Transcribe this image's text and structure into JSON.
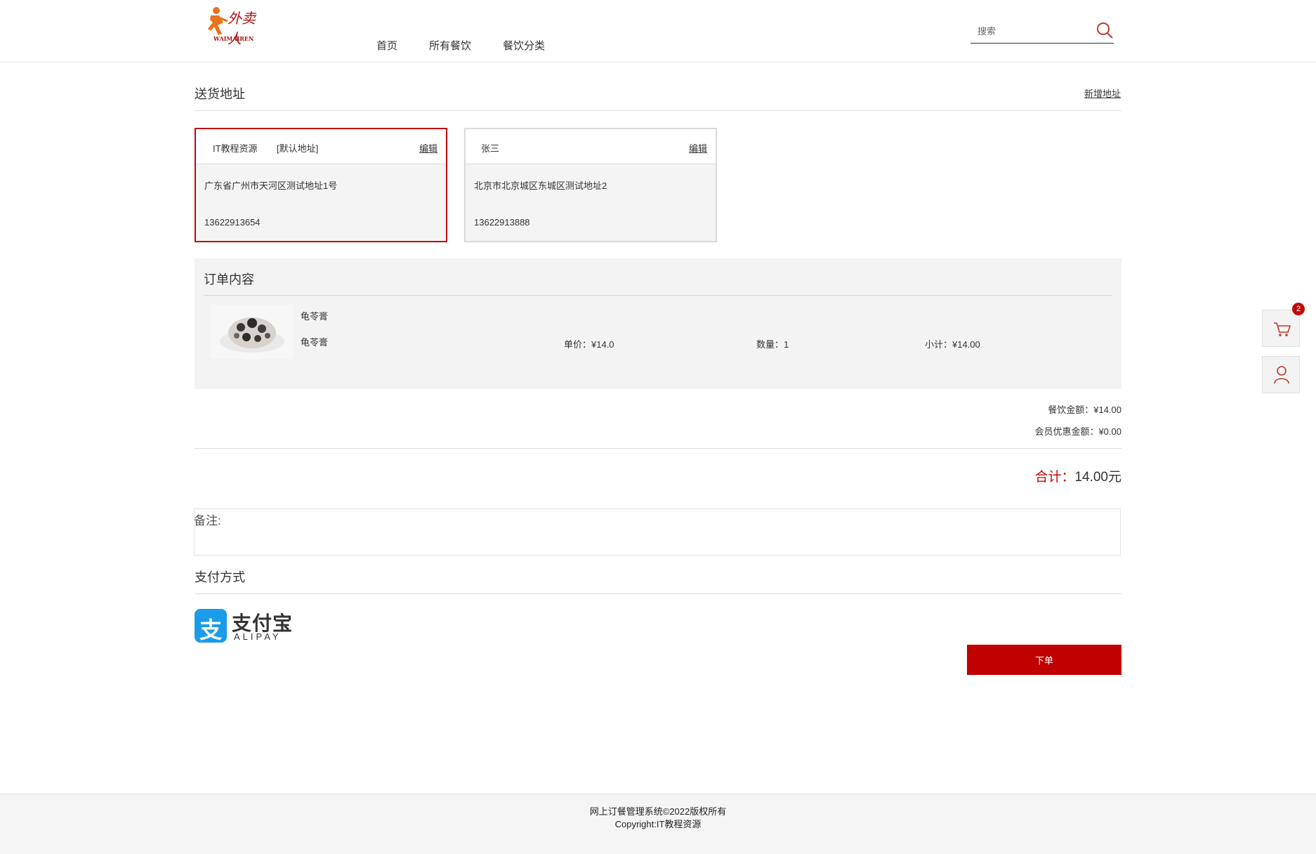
{
  "header": {
    "logo_cn": "外卖人",
    "logo_en": "WAIMAIREN",
    "nav": [
      {
        "label": "首页"
      },
      {
        "label": "所有餐饮"
      },
      {
        "label": "餐饮分类"
      }
    ],
    "search_placeholder": "搜索"
  },
  "address_section": {
    "title": "送货地址",
    "add_link": "新增地址",
    "cards": [
      {
        "name": "IT教程资源",
        "tag": "[默认地址]",
        "edit": "编辑",
        "address": "广东省广州市天河区测试地址1号",
        "phone": "13622913654",
        "selected": true
      },
      {
        "name": "张三",
        "tag": "",
        "edit": "编辑",
        "address": "北京市北京城区东城区测试地址2",
        "phone": "13622913888",
        "selected": false
      }
    ]
  },
  "order": {
    "title": "订单内容",
    "items": [
      {
        "name": "龟苓膏",
        "desc": "龟苓膏",
        "unit_price_label": "单价：¥14.0",
        "qty_label": "数量：1",
        "subtotal_label": "小计：¥14.00"
      }
    ]
  },
  "cart_badge": "2",
  "totals": {
    "food_amount": "餐饮金额：¥14.00",
    "member_discount": "会员优惠金额：¥0.00",
    "grand_label": "合计：",
    "grand_value": "14.00元"
  },
  "remark": {
    "label": "备注:",
    "value": ""
  },
  "payment": {
    "title": "支付方式",
    "alipay_cn": "支付宝",
    "alipay_en": "ALIPAY",
    "alipay_glyph": "支"
  },
  "submit_label": "下单",
  "footer": {
    "line1": "网上订餐管理系统©2022版权所有",
    "line2": "Copyright:IT教程资源"
  },
  "colors": {
    "accent": "#c10a0a",
    "alipay_blue": "#1b9cea"
  }
}
